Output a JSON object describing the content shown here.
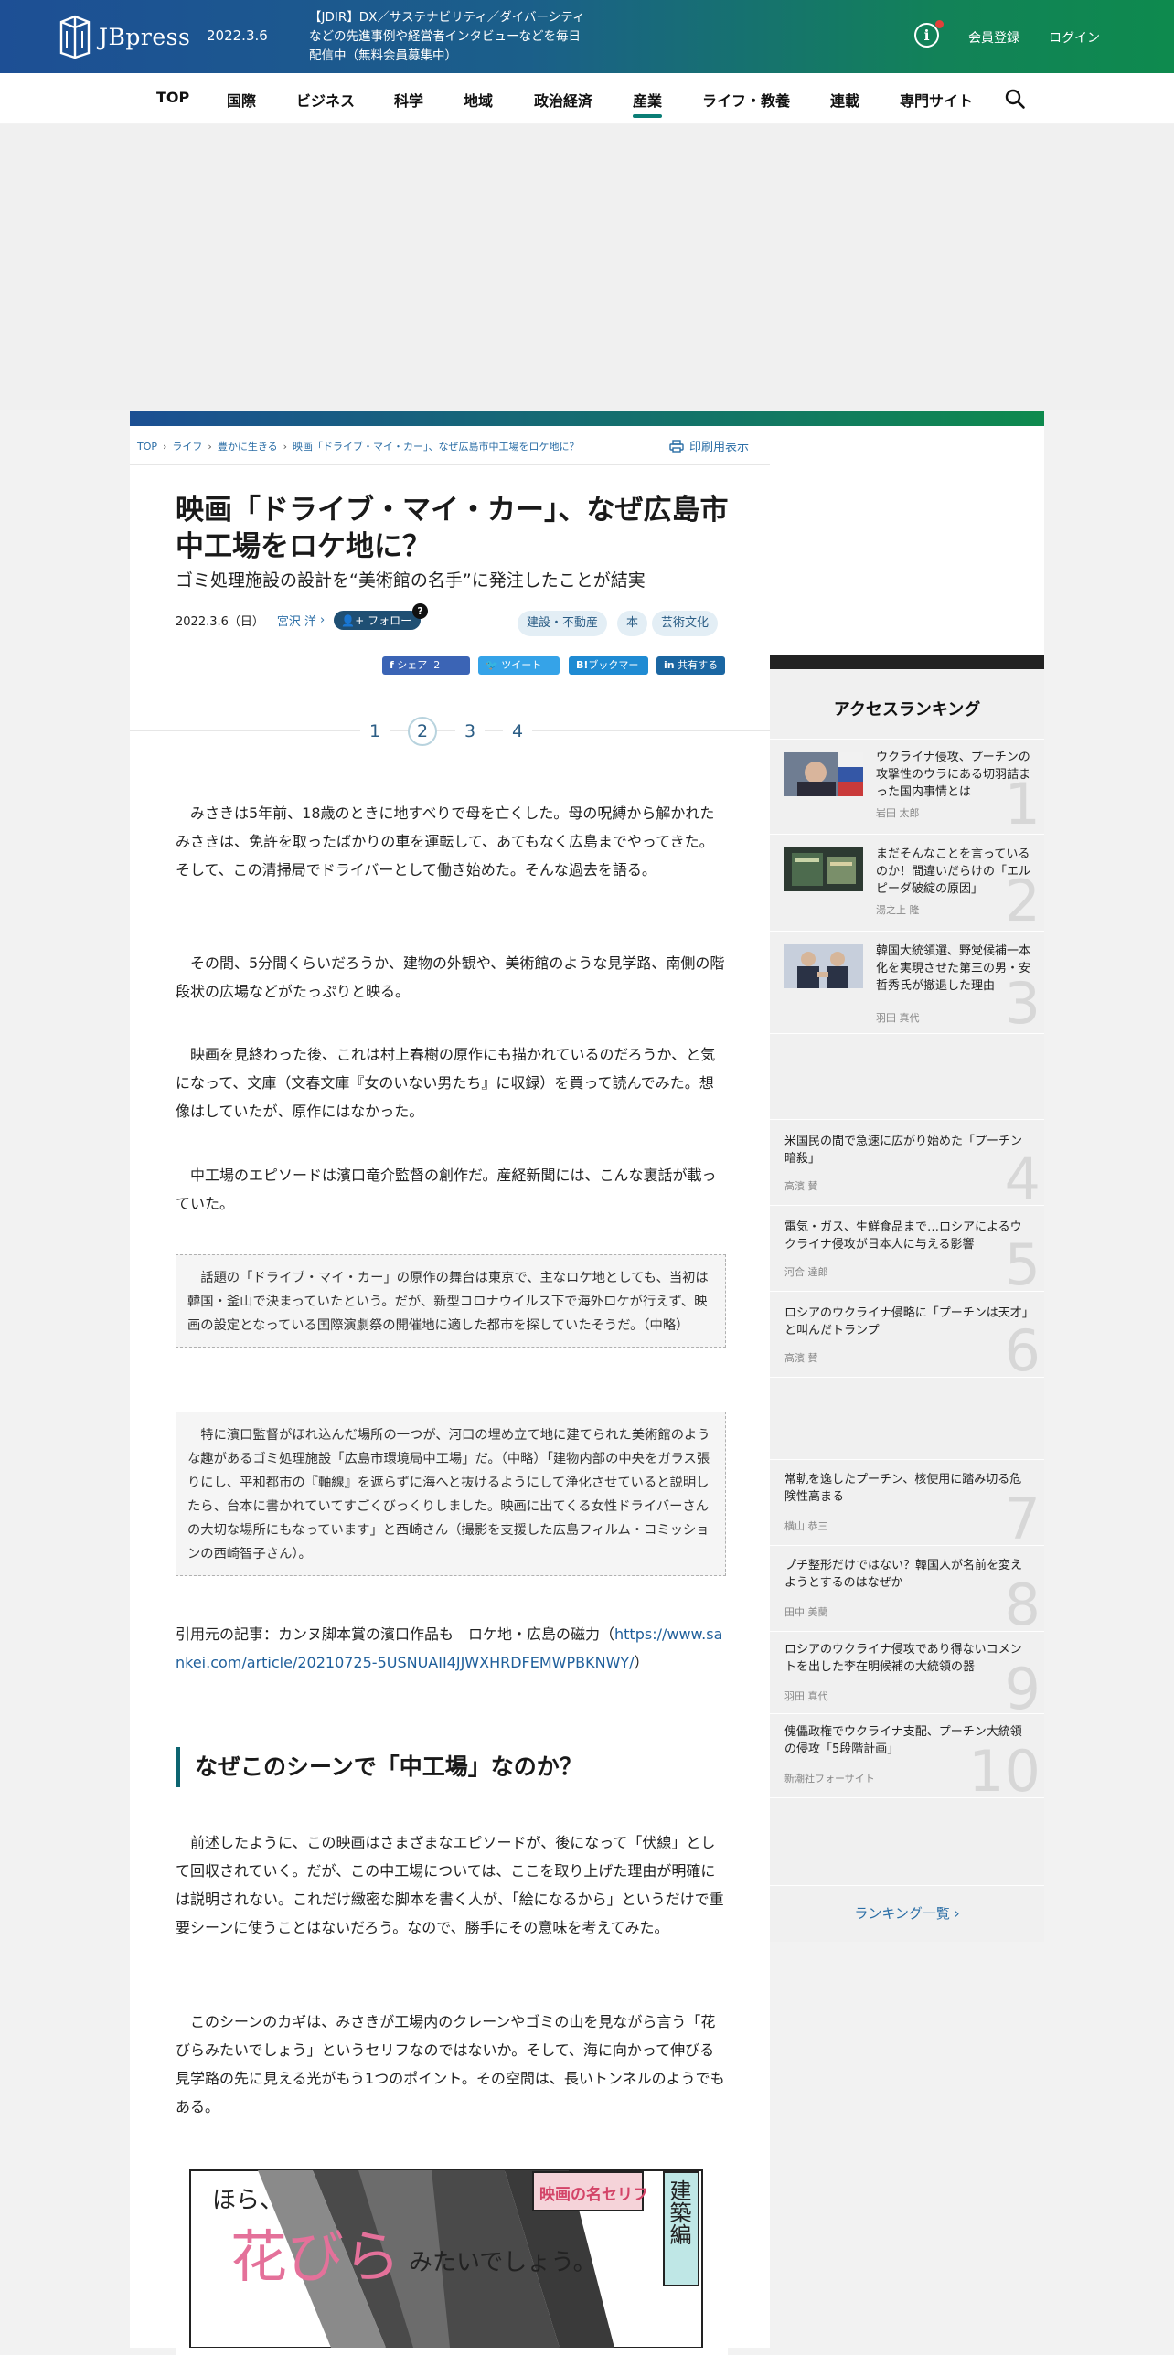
{
  "header": {
    "logo_text": "JBpress",
    "date": "2022.3.6",
    "news": "【JDIR】DX／サステナビリティ／ダイバーシティなどの先進事例や経営者インタビューなどを毎日配信中（無料会員募集中）",
    "info_label": "i",
    "register": "会員登録",
    "login": "ログイン"
  },
  "nav": {
    "items": [
      "TOP",
      "国際",
      "ビジネス",
      "科学",
      "地域",
      "政治経済",
      "産業",
      "ライフ・教養",
      "連載",
      "専門サイト"
    ],
    "active": "産業"
  },
  "breadcrumb": [
    "TOP",
    "ライフ",
    "豊かに生きる",
    "映画「ドライブ・マイ・カー」、なぜ広島市中工場をロケ地に？"
  ],
  "print_label": "印刷用表示",
  "article": {
    "title": "映画「ドライブ・マイ・カー」、なぜ広島市中工場をロケ地に？",
    "subtitle": "ゴミ処理施設の設計を“美術館の名手”に発注したことが結実",
    "date": "2022.3.6（日）",
    "author": "宮沢 洋",
    "follow": "フォロー",
    "tags": [
      "建設・不動産",
      "本",
      "芸術文化"
    ],
    "share": {
      "facebook": "シェア",
      "facebook_count": "2",
      "twitter": "ツイート",
      "hatena": "ブックマーク",
      "linkedin": "共有する"
    },
    "pages": [
      "1",
      "2",
      "3",
      "4"
    ],
    "current_page": "2",
    "p1": "みさきは5年前、18歳のときに地すべりで母を亡くした。母の呪縛から解かれたみさきは、免許を取ったばかりの車を運転して、あてもなく広島までやってきた。そして、この清掃局でドライバーとして働き始めた。そんな過去を語る。",
    "p2": "その間、5分間くらいだろうか、建物の外観や、美術館のような見学路、南側の階段状の広場などがたっぷりと映る。",
    "p3": "映画を見終わった後、これは村上春樹の原作にも描かれているのだろうか、と気になって、文庫（文春文庫『女のいない男たち』に収録）を買って読んでみた。想像はしていたが、原作にはなかった。",
    "p4": "中工場のエピソードは濱口竜介監督の創作だ。産経新聞には、こんな裏話が載っていた。",
    "quote1": "話題の「ドライブ・マイ・カー」の原作の舞台は東京で、主なロケ地としても、当初は韓国・釜山で決まっていたという。だが、新型コロナウイルス下で海外ロケが行えず、映画の設定となっている国際演劇祭の開催地に適した都市を探していたそうだ。（中略）",
    "quote2": "特に濱口監督がほれ込んだ場所の一つが、河口の埋め立て地に建てられた美術館のような趣があるゴミ処理施設「広島市環境局中工場」だ。（中略）「建物内部の中央をガラス張りにし、平和都市の『軸線』を遮らずに海へと抜けるようにして浄化させていると説明したら、台本に書かれていてすごくびっくりしました。映画に出てくる女性ドライバーさんの大切な場所にもなっています」と西崎さん（撮影を支援した広島フィルム・コミッションの西崎智子さん）。",
    "source_prefix": "引用元の記事：カンヌ脚本賞の濱口作品も　ロケ地・広島の磁力（",
    "source_url": "https://www.sankei.com/article/20210725-5USNUAII4JJWXHRDFEMWPBKNWY/",
    "source_suffix": "）",
    "h2": "なぜこのシーンで「中工場」なのか？",
    "p5": "前述したように、この映画はさまざまなエピソードが、後になって「伏線」として回収されていく。だが、この中工場については、ここを取り上げた理由が明確には説明されない。これだけ緻密な脚本を書く人が、「絵になるから」というだけで重要シーンに使うことはないだろう。なので、勝手にその意味を考えてみた。",
    "p6": "このシーンのカギは、みさきが工場内のクレーンやゴミの山を見ながら言う「花びらみたいでしょう」というセリフなのではないか。そして、海に向かって伸びる見学路の先に見える光がもう1つのポイント。その空間は、長いトンネルのようでもある。",
    "illust": {
      "hora": "ほら、",
      "big": "花びら",
      "rest": "みたいでしょう。",
      "badge": "映画の名セリフ",
      "side": "建築編"
    }
  },
  "ranking": {
    "title": "アクセスランキング",
    "items": [
      {
        "rank": "1",
        "title": "ウクライナ侵攻、プーチンの攻撃性のウラにある切羽詰まった国内事情とは",
        "author": "岩田 太郎"
      },
      {
        "rank": "2",
        "title": "まだそんなことを言っているのか！間違いだらけの「エルピーダ破綻の原因」",
        "author": "湯之上 隆"
      },
      {
        "rank": "3",
        "title": "韓国大統領選、野党候補一本化を実現させた第三の男・安哲秀氏が撤退した理由",
        "author": "羽田 真代"
      },
      {
        "rank": "4",
        "title": "米国民の間で急速に広がり始めた「プーチン暗殺」",
        "author": "高濱 賛"
      },
      {
        "rank": "5",
        "title": "電気・ガス、生鮮食品まで…ロシアによるウクライナ侵攻が日本人に与える影響",
        "author": "河合 達郎"
      },
      {
        "rank": "6",
        "title": "ロシアのウクライナ侵略に「プーチンは天才」と叫んだトランプ",
        "author": "高濱 賛"
      },
      {
        "rank": "7",
        "title": "常軌を逸したプーチン、核使用に踏み切る危険性高まる",
        "author": "横山 恭三"
      },
      {
        "rank": "8",
        "title": "プチ整形だけではない？韓国人が名前を変えようとするのはなぜか",
        "author": "田中 美蘭"
      },
      {
        "rank": "9",
        "title": "ロシアのウクライナ侵攻であり得ないコメントを出した李在明候補の大統領の器",
        "author": "羽田 真代"
      },
      {
        "rank": "10",
        "title": "傀儡政権でウクライナ支配、プーチン大統領の侵攻「5段階計画」",
        "author": "新潮社フォーサイト"
      }
    ],
    "more": "ランキング一覧 ›"
  },
  "colors": {
    "brand_blue": "#1d4f95",
    "brand_green": "#0e8a4e",
    "accent_teal": "#0a7e76",
    "link": "#2b6ea6"
  }
}
